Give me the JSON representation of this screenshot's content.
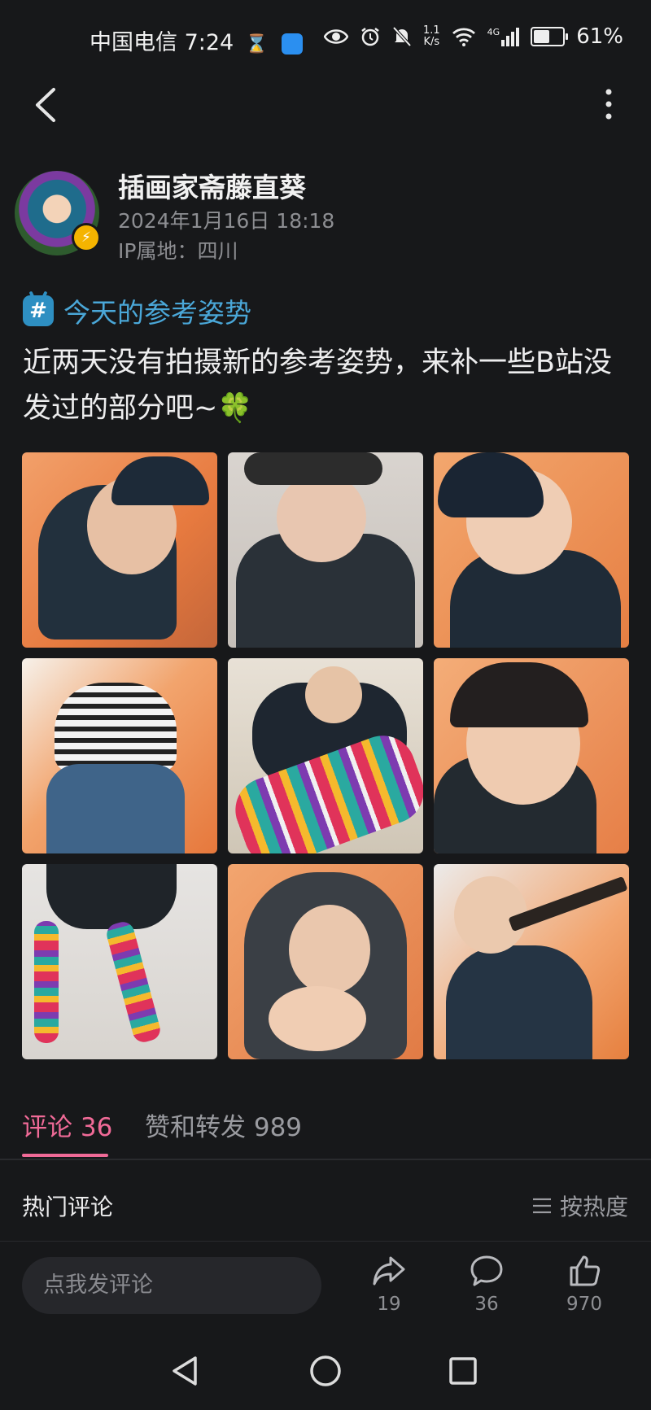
{
  "status_bar": {
    "carrier_time": "中国电信 7:24",
    "net_speed_top": "1.1",
    "net_speed_bottom": "K/s",
    "network": "4G",
    "battery_percent": "61%",
    "battery_level": 0.61
  },
  "header": {
    "back_icon": "chevron-left-icon",
    "more_icon": "vertical-dots-icon"
  },
  "author": {
    "name": "插画家斋藤直葵",
    "time": "2024年1月16日 18:18",
    "ip": "IP属地：四川"
  },
  "post": {
    "topic": "今天的参考姿势",
    "topic_symbol": "#",
    "text": "近两天没有拍摄新的参考姿势，来补一些B站没发过的部分吧~🍀"
  },
  "tabs": {
    "comments": "评论 36",
    "likes": "赞和转发 989"
  },
  "comments_section": {
    "hot": "热门评论",
    "sort": "按热度"
  },
  "bottom_bar": {
    "placeholder": "点我发评论",
    "share_count": "19",
    "comment_count": "36",
    "like_count": "970"
  }
}
